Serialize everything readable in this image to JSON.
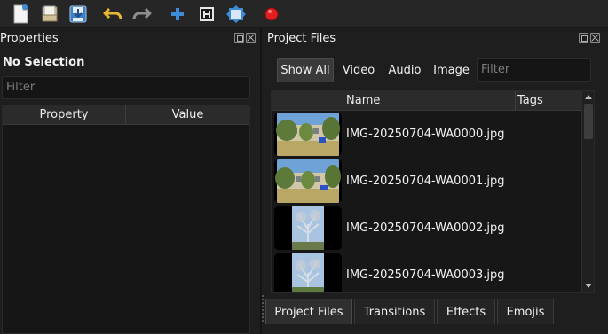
{
  "toolbar": {
    "buttons": [
      {
        "name": "new-project",
        "icon": "new-file-icon"
      },
      {
        "name": "open-project",
        "icon": "open-file-icon"
      },
      {
        "name": "save-project",
        "icon": "save-icon"
      },
      {
        "name": "undo",
        "icon": "undo-icon"
      },
      {
        "name": "redo",
        "icon": "redo-icon"
      },
      {
        "name": "import-files",
        "icon": "plus-icon"
      },
      {
        "name": "choose-profile",
        "icon": "profile-icon"
      },
      {
        "name": "fullscreen",
        "icon": "fullscreen-icon"
      },
      {
        "name": "export-video",
        "icon": "record-icon"
      }
    ],
    "colors": {
      "accent_blue": "#3d8bd9",
      "undo_yellow": "#e8b830",
      "record_red": "#e02020"
    }
  },
  "properties_panel": {
    "title": "Properties",
    "selection_label": "No Selection",
    "filter_placeholder": "Filter",
    "columns": [
      "Property",
      "Value"
    ]
  },
  "project_files_panel": {
    "title": "Project Files",
    "filter_buttons": [
      "Show All",
      "Video",
      "Audio",
      "Image"
    ],
    "active_filter": "Show All",
    "filter_placeholder": "Filter",
    "columns": [
      "Name",
      "Tags"
    ],
    "files": [
      {
        "name": "IMG-20250704-WA0000.jpg",
        "thumb": "building-photo"
      },
      {
        "name": "IMG-20250704-WA0001.jpg",
        "thumb": "building-photo"
      },
      {
        "name": "IMG-20250704-WA0002.jpg",
        "thumb": "sculpture-photo"
      },
      {
        "name": "IMG-20250704-WA0003.jpg",
        "thumb": "sculpture-photo"
      }
    ]
  },
  "bottom_tabs": [
    "Project Files",
    "Transitions",
    "Effects",
    "Emojis"
  ],
  "active_tab": "Project Files"
}
